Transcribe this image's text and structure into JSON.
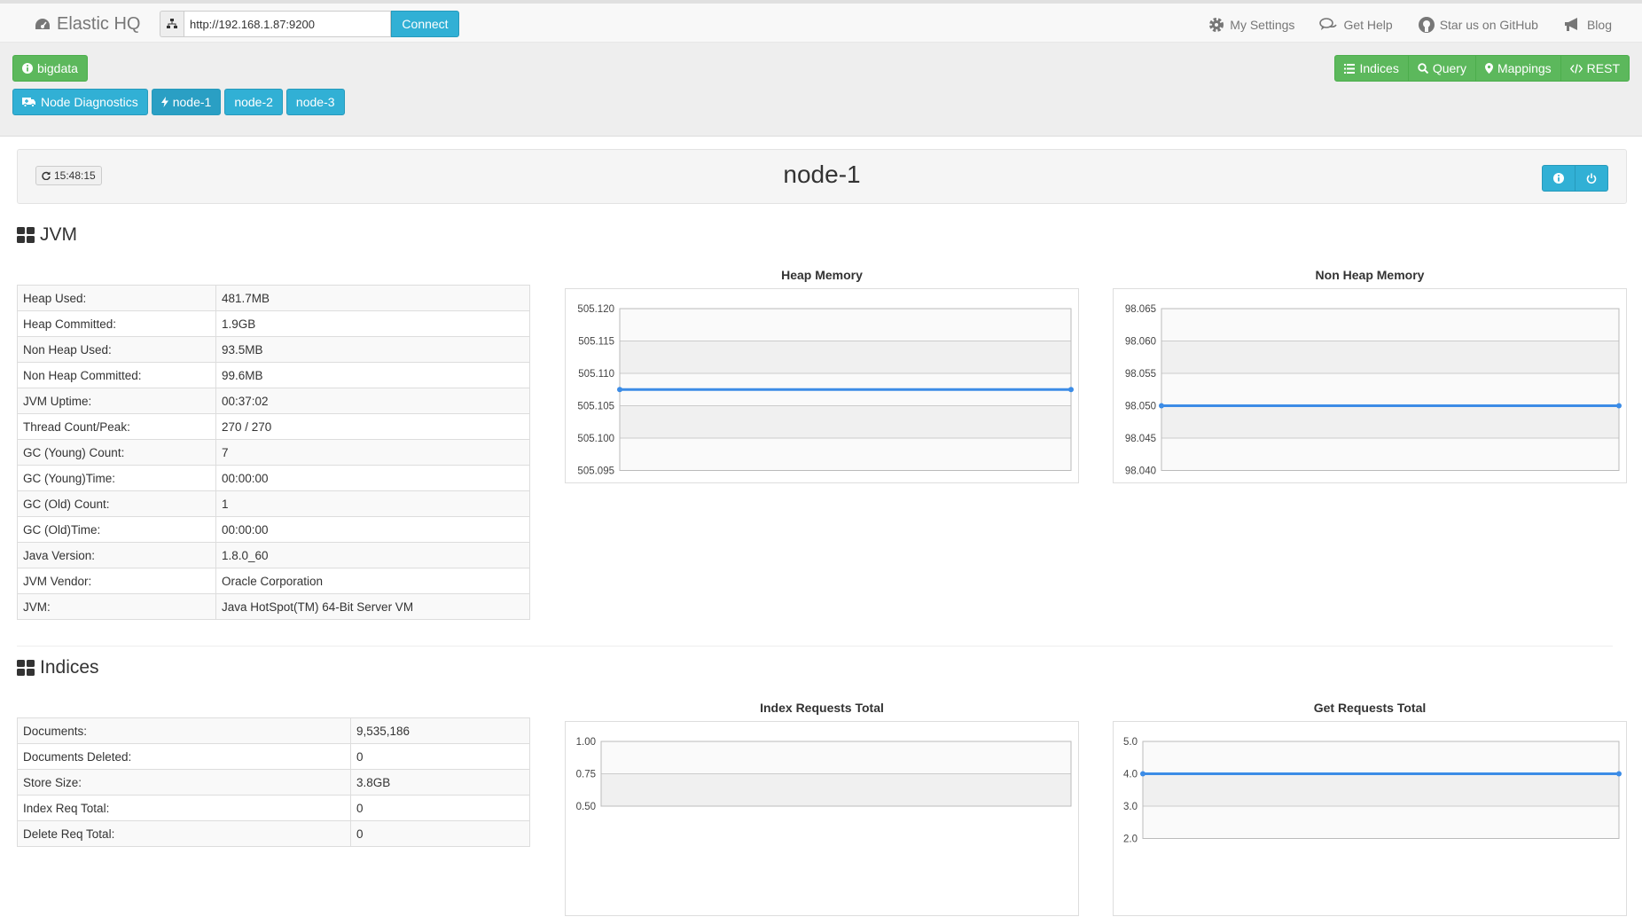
{
  "navbar": {
    "brand": "Elastic HQ",
    "url_value": "http://192.168.1.87:9200",
    "connect_label": "Connect",
    "links": {
      "settings": "My Settings",
      "help": "Get Help",
      "github": "Star us on GitHub",
      "blog": "Blog"
    }
  },
  "toolbar": {
    "cluster_label": "bigdata",
    "diagnostics_label": "Node Diagnostics",
    "nodes": [
      "node-1",
      "node-2",
      "node-3"
    ],
    "indices_label": "Indices",
    "query_label": "Query",
    "mappings_label": "Mappings",
    "rest_label": "REST"
  },
  "node": {
    "refresh_time": "15:48:15",
    "name": "node-1"
  },
  "jvm": {
    "heading": "JVM",
    "rows": [
      {
        "label": "Heap Used:",
        "value": "481.7MB"
      },
      {
        "label": "Heap Committed:",
        "value": "1.9GB"
      },
      {
        "label": "Non Heap Used:",
        "value": "93.5MB"
      },
      {
        "label": "Non Heap Committed:",
        "value": "99.6MB"
      },
      {
        "label": "JVM Uptime:",
        "value": "00:37:02"
      },
      {
        "label": "Thread Count/Peak:",
        "value": "270 / 270"
      },
      {
        "label": "GC (Young) Count:",
        "value": "7"
      },
      {
        "label": "GC (Young)Time:",
        "value": "00:00:00"
      },
      {
        "label": "GC (Old) Count:",
        "value": "1"
      },
      {
        "label": "GC (Old)Time:",
        "value": "00:00:00"
      },
      {
        "label": "Java Version:",
        "value": "1.8.0_60"
      },
      {
        "label": "JVM Vendor:",
        "value": "Oracle Corporation"
      },
      {
        "label": "JVM:",
        "value": "Java HotSpot(TM) 64-Bit Server VM"
      }
    ]
  },
  "indices": {
    "heading": "Indices",
    "rows": [
      {
        "label": "Documents:",
        "value": "9,535,186"
      },
      {
        "label": "Documents Deleted:",
        "value": "0"
      },
      {
        "label": "Store Size:",
        "value": "3.8GB"
      },
      {
        "label": "Index Req Total:",
        "value": "0"
      },
      {
        "label": "Delete Req Total:",
        "value": "0"
      }
    ]
  },
  "colors": {
    "line": "#3c8ce6",
    "green": "#5cb85c",
    "blue": "#31b0d5"
  },
  "chart_data": [
    {
      "type": "line",
      "title": "Heap Memory",
      "yticks": [
        "505.120",
        "505.115",
        "505.110",
        "505.105",
        "505.100",
        "505.095"
      ],
      "ylim": [
        505.095,
        505.12
      ],
      "x": [
        0,
        1
      ],
      "values": [
        505.1075,
        505.1075
      ]
    },
    {
      "type": "line",
      "title": "Non Heap Memory",
      "yticks": [
        "98.065",
        "98.060",
        "98.055",
        "98.050",
        "98.045",
        "98.040"
      ],
      "ylim": [
        98.04,
        98.065
      ],
      "x": [
        0,
        1
      ],
      "values": [
        98.05,
        98.05
      ]
    },
    {
      "type": "line",
      "title": "Index Requests Total",
      "yticks": [
        "1.00",
        "0.75",
        "0.50"
      ],
      "ylim": [
        0.5,
        1.0
      ],
      "x": [],
      "values": []
    },
    {
      "type": "line",
      "title": "Get Requests Total",
      "yticks": [
        "5.0",
        "4.0",
        "3.0",
        "2.0"
      ],
      "ylim": [
        2.0,
        5.0
      ],
      "x": [
        0,
        1
      ],
      "values": [
        4.0,
        4.0
      ]
    }
  ]
}
